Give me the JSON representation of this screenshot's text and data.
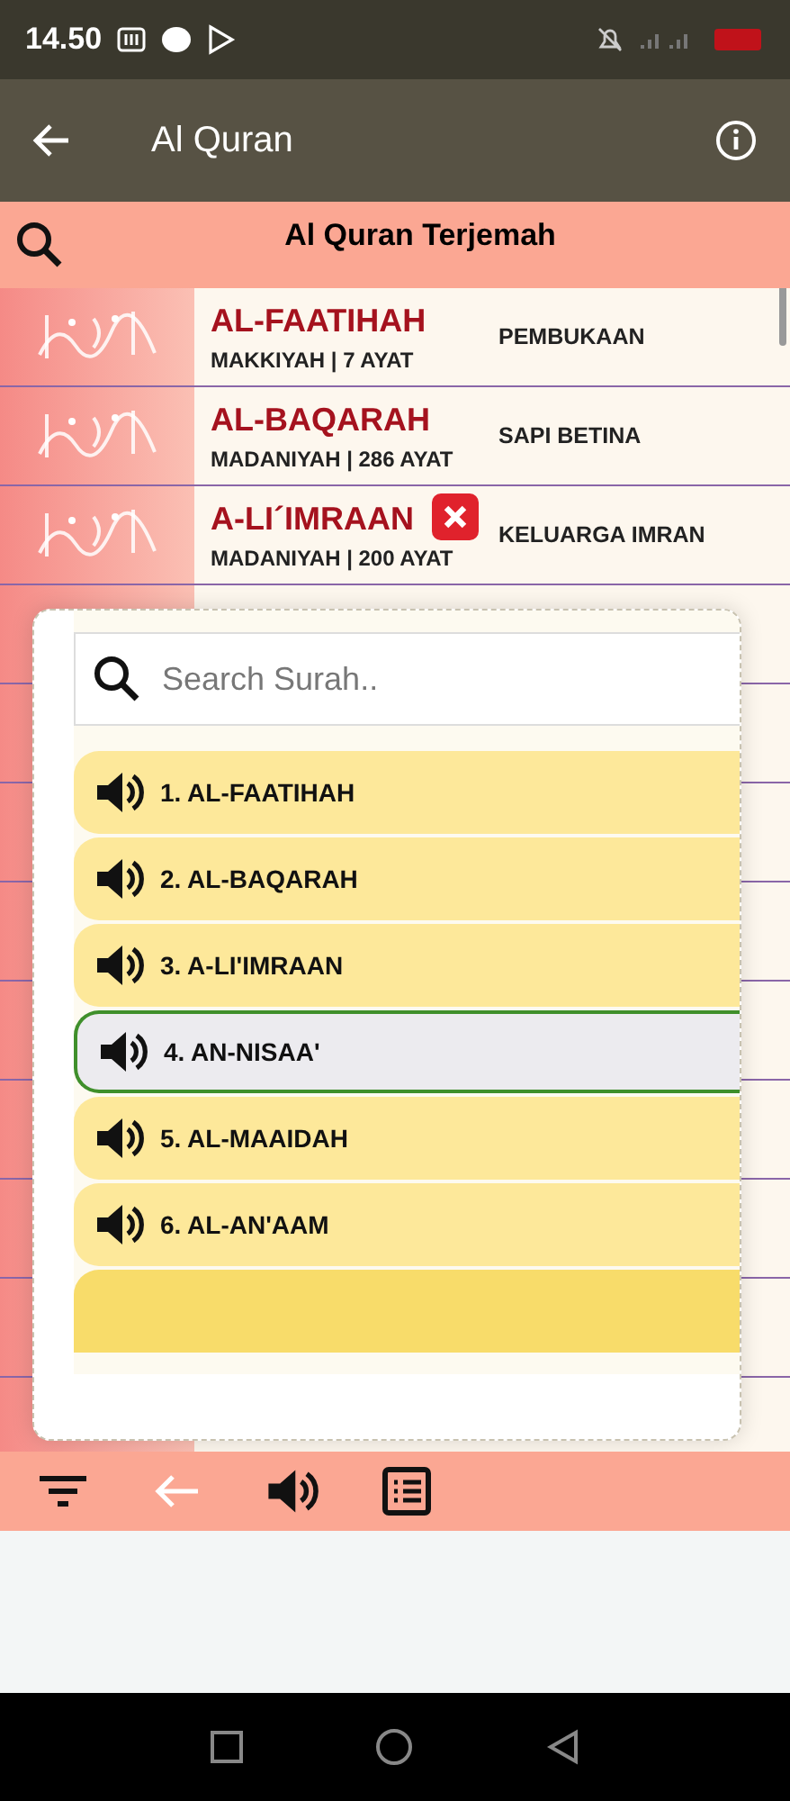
{
  "status_bar": {
    "time": "14.50"
  },
  "app_bar": {
    "title": "Al Quran"
  },
  "header": {
    "title": "Al Quran Terjemah"
  },
  "surahs": [
    {
      "name": "AL-FAATIHAH",
      "info": "MAKKIYAH | 7 AYAT",
      "meaning": "PEMBUKAAN"
    },
    {
      "name": "AL-BAQARAH",
      "info": "MADANIYAH | 286 AYAT",
      "meaning": "SAPI BETINA"
    },
    {
      "name": "A-LI´IMRAAN",
      "info": "MADANIYAH | 200 AYAT",
      "meaning": "KELUARGA IMRAN"
    }
  ],
  "popup": {
    "search": {
      "placeholder": "Search Surah.."
    },
    "items": [
      {
        "label": "1. AL-FAATIHAH",
        "selected": false
      },
      {
        "label": "2. AL-BAQARAH",
        "selected": false
      },
      {
        "label": "3. A-LI'IMRAAN",
        "selected": false
      },
      {
        "label": "4. AN-NISAA'",
        "selected": true
      },
      {
        "label": "5. AL-MAAIDAH",
        "selected": false
      },
      {
        "label": "6. AL-AN'AAM",
        "selected": false
      }
    ]
  }
}
